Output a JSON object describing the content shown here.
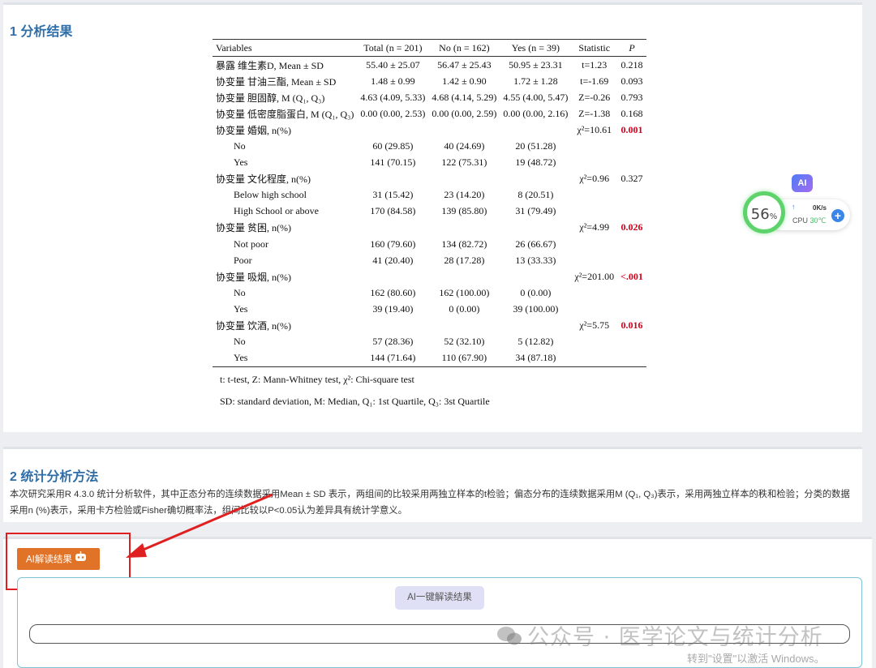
{
  "section1": {
    "title": "1 分析结果",
    "table": {
      "headers": [
        "Variables",
        "Total (n = 201)",
        "No (n = 162)",
        "Yes (n = 39)",
        "Statistic",
        "P"
      ],
      "rows": [
        {
          "var": "暴露 维生素D, Mean ± SD",
          "total": "55.40 ± 25.07",
          "no": "56.47 ± 25.43",
          "yes": "50.95 ± 23.31",
          "stat": "t=1.23",
          "p": "0.218",
          "sig": false,
          "sub": false
        },
        {
          "var": "协变量 甘油三酯, Mean ± SD",
          "total": "1.48 ± 0.99",
          "no": "1.42 ± 0.90",
          "yes": "1.72 ± 1.28",
          "stat": "t=-1.69",
          "p": "0.093",
          "sig": false,
          "sub": false
        },
        {
          "var": "协变量 胆固醇, M (Q₁, Q₃)",
          "total": "4.63 (4.09, 5.33)",
          "no": "4.68 (4.14, 5.29)",
          "yes": "4.55 (4.00, 5.47)",
          "stat": "Z=-0.26",
          "p": "0.793",
          "sig": false,
          "sub": false
        },
        {
          "var": "协变量 低密度脂蛋白, M (Q₁, Q₃)",
          "total": "0.00 (0.00, 2.53)",
          "no": "0.00 (0.00, 2.59)",
          "yes": "0.00 (0.00, 2.16)",
          "stat": "Z=-1.38",
          "p": "0.168",
          "sig": false,
          "sub": false
        },
        {
          "var": "协变量 婚姻, n(%)",
          "total": "",
          "no": "",
          "yes": "",
          "stat": "χ²=10.61",
          "p": "0.001",
          "sig": true,
          "sub": false
        },
        {
          "var": "No",
          "total": "60 (29.85)",
          "no": "40 (24.69)",
          "yes": "20 (51.28)",
          "stat": "",
          "p": "",
          "sig": false,
          "sub": true
        },
        {
          "var": "Yes",
          "total": "141 (70.15)",
          "no": "122 (75.31)",
          "yes": "19 (48.72)",
          "stat": "",
          "p": "",
          "sig": false,
          "sub": true
        },
        {
          "var": "协变量 文化程度, n(%)",
          "total": "",
          "no": "",
          "yes": "",
          "stat": "χ²=0.96",
          "p": "0.327",
          "sig": false,
          "sub": false
        },
        {
          "var": "Below high school",
          "total": "31 (15.42)",
          "no": "23 (14.20)",
          "yes": "8 (20.51)",
          "stat": "",
          "p": "",
          "sig": false,
          "sub": true
        },
        {
          "var": "High School or above",
          "total": "170 (84.58)",
          "no": "139 (85.80)",
          "yes": "31 (79.49)",
          "stat": "",
          "p": "",
          "sig": false,
          "sub": true
        },
        {
          "var": "协变量 贫困, n(%)",
          "total": "",
          "no": "",
          "yes": "",
          "stat": "χ²=4.99",
          "p": "0.026",
          "sig": true,
          "sub": false
        },
        {
          "var": "Not poor",
          "total": "160 (79.60)",
          "no": "134 (82.72)",
          "yes": "26 (66.67)",
          "stat": "",
          "p": "",
          "sig": false,
          "sub": true
        },
        {
          "var": "Poor",
          "total": "41 (20.40)",
          "no": "28 (17.28)",
          "yes": "13 (33.33)",
          "stat": "",
          "p": "",
          "sig": false,
          "sub": true
        },
        {
          "var": "协变量 吸烟, n(%)",
          "total": "",
          "no": "",
          "yes": "",
          "stat": "χ²=201.00",
          "p": "<.001",
          "sig": true,
          "sub": false
        },
        {
          "var": "No",
          "total": "162 (80.60)",
          "no": "162 (100.00)",
          "yes": "0 (0.00)",
          "stat": "",
          "p": "",
          "sig": false,
          "sub": true
        },
        {
          "var": "Yes",
          "total": "39 (19.40)",
          "no": "0 (0.00)",
          "yes": "39 (100.00)",
          "stat": "",
          "p": "",
          "sig": false,
          "sub": true
        },
        {
          "var": "协变量 饮酒, n(%)",
          "total": "",
          "no": "",
          "yes": "",
          "stat": "χ²=5.75",
          "p": "0.016",
          "sig": true,
          "sub": false
        },
        {
          "var": "No",
          "total": "57 (28.36)",
          "no": "52 (32.10)",
          "yes": "5 (12.82)",
          "stat": "",
          "p": "",
          "sig": false,
          "sub": true
        },
        {
          "var": "Yes",
          "total": "144 (71.64)",
          "no": "110 (67.90)",
          "yes": "34 (87.18)",
          "stat": "",
          "p": "",
          "sig": false,
          "sub": true
        }
      ]
    },
    "footnote1": "t: t-test, Z: Mann-Whitney test, χ²: Chi-square test",
    "footnote2": "SD: standard deviation, M: Median, Q₁: 1st Quartile, Q₃: 3st Quartile"
  },
  "monitor": {
    "ai_badge": "AI",
    "value": "56",
    "unit": "%",
    "up_arrow": "↑",
    "speed": "0K/s",
    "cpu_label": "CPU",
    "cpu_temp": "30℃",
    "plus": "+"
  },
  "section2": {
    "title": "2 统计分析方法",
    "text": "本次研究采用R 4.3.0 统计分析软件，其中正态分布的连续数据采用Mean ± SD 表示，两组间的比较采用两独立样本的t检验；偏态分布的连续数据采用M (Q₁, Q₃)表示，采用两独立样本的秩和检验；分类的数据采用n (%)表示，采用卡方检验或Fisher确切概率法，组间比较以P<0.05认为差异具有统计学意义。"
  },
  "section3": {
    "ai_read_button": "AI解读结果",
    "ai_oneclick_button": "AI一键解读结果"
  },
  "watermark": {
    "text": "公众号 · 医学论文与统计分析",
    "windows": "转到\"设置\"以激活 Windows。"
  },
  "colors": {
    "accent_blue": "#2f6ea8",
    "button_orange": "#e07328",
    "significant_red": "#d0021b",
    "highlight_red": "#e02020"
  }
}
